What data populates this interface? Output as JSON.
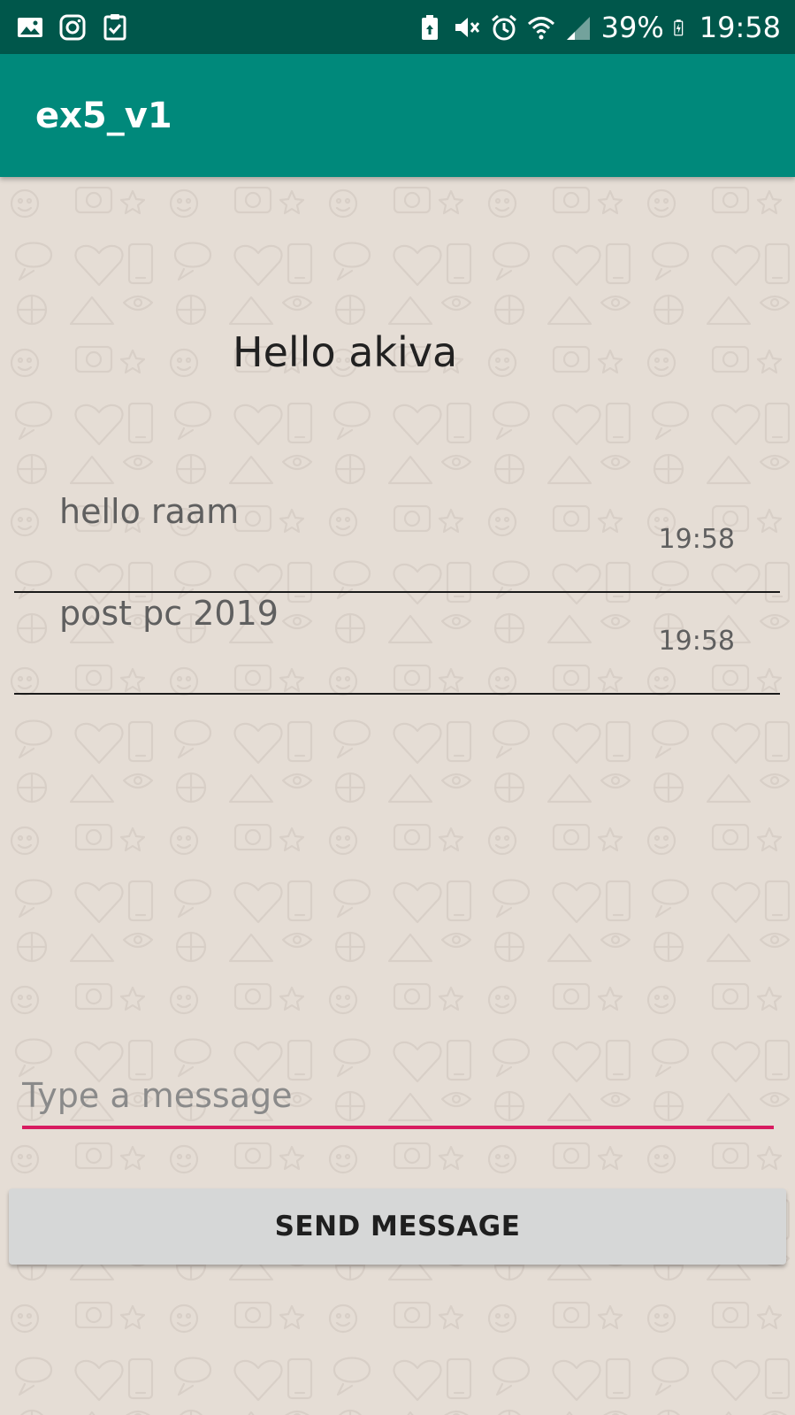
{
  "status_bar": {
    "left_icons": [
      "gallery-icon",
      "instagram-icon",
      "checklist-icon"
    ],
    "right_icons": [
      "battery-saver-icon",
      "vibrate-icon",
      "alarm-icon",
      "wifi-icon",
      "signal-icon"
    ],
    "battery": "39%",
    "battery_icon": "battery-charging-icon",
    "time": "19:58"
  },
  "app_bar": {
    "title": "ex5_v1"
  },
  "chat": {
    "greeting": "Hello akiva",
    "messages": [
      {
        "text": "hello raam",
        "time": "19:58"
      },
      {
        "text": "post pc 2019",
        "time": "19:58"
      }
    ]
  },
  "composer": {
    "placeholder": "Type a message",
    "value": "",
    "send_label": "SEND MESSAGE"
  },
  "colors": {
    "status_bar": "#00574b",
    "app_bar": "#00897b",
    "background": "#e5ddd5",
    "input_underline": "#d81b60",
    "button": "#d6d7d7"
  }
}
